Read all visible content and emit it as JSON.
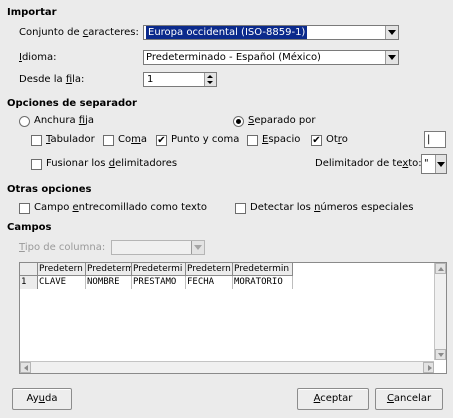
{
  "importar": {
    "heading": "Importar",
    "charset_label_pre": "Conjunto de ",
    "charset_label_u": "c",
    "charset_label_post": "aracteres:",
    "charset_value": "Europa occidental (ISO-8859-1)",
    "idioma_label_u": "I",
    "idioma_label_post": "dioma:",
    "idioma_value": "Predeterminado - Español (México)",
    "fila_label_pre": "Desde la ",
    "fila_label_u": "f",
    "fila_label_post": "ila:",
    "fila_value": "1"
  },
  "separador": {
    "heading": "Opciones de separador",
    "anchura_pre": "Anchura ",
    "anchura_u": "f",
    "anchura_post": "ija",
    "separado_u": "S",
    "separado_post": "eparado por",
    "tab_u": "T",
    "tab_post": "abulador",
    "coma_pre": "Co",
    "coma_u": "m",
    "coma_post": "a",
    "punto": "Punto y coma",
    "espacio_u": "E",
    "espacio_post": "spacio",
    "otro_pre": "Ot",
    "otro_u": "r",
    "otro_post": "o",
    "otro_value": "|",
    "fusionar_pre": "Fusionar los ",
    "fusionar_u": "d",
    "fusionar_post": "elimitadores",
    "delim_pre": "Delimitador de te",
    "delim_u": "x",
    "delim_post": "to:",
    "delim_value": "\""
  },
  "otras": {
    "heading": "Otras opciones",
    "campo_pre": "Campo ",
    "campo_u": "e",
    "campo_post": "ntrecomillado como texto",
    "detectar_pre": "Detectar los ",
    "detectar_u": "n",
    "detectar_post": "úmeros especiales"
  },
  "campos": {
    "heading": "Campos",
    "tipo_u": "T",
    "tipo_post": "ipo de columna:",
    "headers": [
      "Predetern",
      "Predeterm",
      "Predetermi",
      "Predetern",
      "Predetermin"
    ],
    "row_number": "1",
    "row": [
      "CLAVE",
      "NOMBRE",
      "PRESTAMO",
      "FECHA",
      "MORATORIO"
    ]
  },
  "buttons": {
    "ayuda_pre": "Ay",
    "ayuda_u": "u",
    "ayuda_post": "da",
    "aceptar_u": "A",
    "aceptar_post": "ceptar",
    "cancelar_u": "C",
    "cancelar_post": "ancelar"
  },
  "colors": {
    "selection": "#0b2a8c",
    "background": "#ebebeb"
  }
}
